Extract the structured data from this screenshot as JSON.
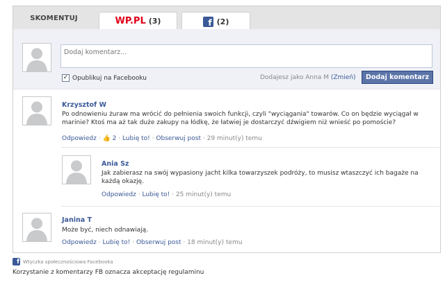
{
  "tabs": {
    "skomentuj": "SKOMENTUJ",
    "wp_label": "WP.PL",
    "wp_count": "(3)",
    "fb_icon": "f",
    "fb_count": "(2)"
  },
  "compose": {
    "placeholder": "Dodaj komentarz...",
    "publish_label": "Opublikuj na Facebooku",
    "publish_checked": "✓",
    "posting_as": "Dodajesz jako Anna M",
    "change_label": "(Zmień)",
    "submit_label": "Dodaj komentarz"
  },
  "comments": [
    {
      "author": "Krzysztof W",
      "text": "Po odnowieniu żuraw ma wrócić do pełnienia swoich funkcji, czyli \"wyciągania\" towarów. Co on będzie wyciągał w marinie? Ktoś ma aż tak duże zakupy na łódkę, że łatwiej je dostarczyć dźwigiem niż wnieść po pomoście?",
      "reply": "Odpowiedz",
      "likes_count": "2",
      "like": "Lubię to!",
      "follow": "Obserwuj post",
      "time": "29 minut(y) temu"
    },
    {
      "author": "Ania Sz",
      "text": "Jak zabierasz na swój wypasiony jacht kilka towarzyszek podróży, to musisz wtaszczyć ich bagaże na każdą okazję.",
      "reply": "Odpowiedz",
      "like": "Lubię to!",
      "time": "25 minut(y) temu"
    },
    {
      "author": "Janina T",
      "text": "Może być, niech odnawiają.",
      "reply": "Odpowiedz",
      "like": "Lubię to!",
      "follow": "Obserwuj post",
      "time": "18 minut(y) temu"
    }
  ],
  "meta_separator": "·",
  "footer": {
    "plugin_icon": "f",
    "plugin_label": "Wtyczka społecznościowa Facebooka",
    "terms": "Korzystanie z komentarzy FB oznacza akceptację regulaminu"
  },
  "colors": {
    "facebook_blue": "#3b5998",
    "wp_red": "#e0001a",
    "button_blue": "#5b74a8"
  },
  "icons": {
    "avatar": "default-profile-silhouette",
    "like": "thumbs-up-icon",
    "facebook": "facebook-f-logo"
  }
}
